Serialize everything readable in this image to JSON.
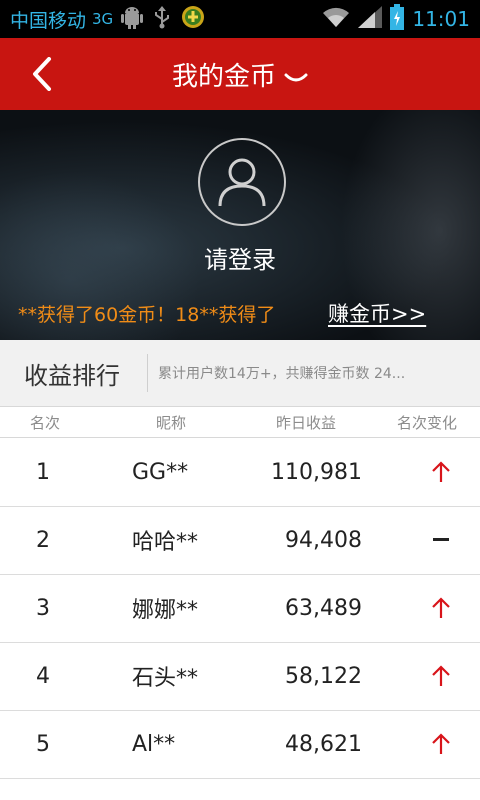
{
  "status_bar": {
    "carrier": "中国移动",
    "network": "3G",
    "time": "11:01",
    "icons": [
      "android-debug-icon",
      "usb-icon",
      "download-icon",
      "wifi-icon",
      "signal-icon",
      "battery-charging-icon"
    ]
  },
  "titlebar": {
    "title": "我的金币",
    "back_icon": "back-chevron-icon",
    "dropdown_icon": "chevron-down-icon"
  },
  "hero": {
    "avatar_icon": "user-avatar-icon",
    "login_text": "请登录",
    "ticker_text": "**获得了60金币！18**获得了",
    "earn_link": "赚金币>>"
  },
  "ranking": {
    "title": "收益排行",
    "summary": "累计用户数14万+，共赚得金币数 24...",
    "columns": [
      "名次",
      "昵称",
      "昨日收益",
      "名次变化"
    ],
    "rows": [
      {
        "rank": "1",
        "name": "GG**",
        "income": "110,981",
        "change": "up"
      },
      {
        "rank": "2",
        "name": "哈哈**",
        "income": "94,408",
        "change": "same"
      },
      {
        "rank": "3",
        "name": "娜娜**",
        "income": "63,489",
        "change": "up"
      },
      {
        "rank": "4",
        "name": "石头**",
        "income": "58,122",
        "change": "up"
      },
      {
        "rank": "5",
        "name": "Al**",
        "income": "48,621",
        "change": "up"
      }
    ]
  },
  "colors": {
    "titlebar_bg": "#c81511",
    "ticker": "#f08c17",
    "up_arrow": "#d8141a",
    "statusbar_text": "#33b5e5"
  }
}
